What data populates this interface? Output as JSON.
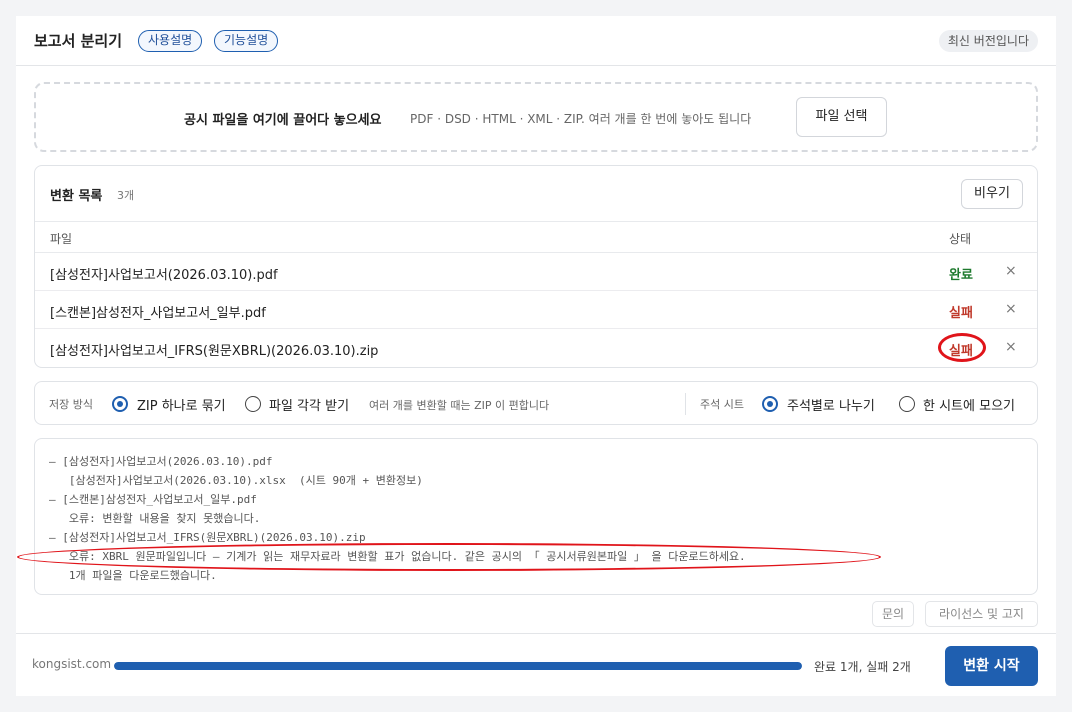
{
  "header": {
    "title": "보고서 분리기",
    "guide_label": "사용설명",
    "features_label": "기능설명",
    "version_badge": "최신 버전입니다"
  },
  "dropzone": {
    "main_text": "공시 파일을 여기에 끌어다 놓으세요",
    "sub_text": "PDF · DSD · HTML · XML · ZIP. 여러 개를 한 번에 놓아도 됩니다",
    "select_label": "파일 선택"
  },
  "list": {
    "title": "변환 목록",
    "count": "3개",
    "clear_label": "비우기",
    "col_file": "파일",
    "col_status": "상태",
    "remove_glyph": "×",
    "rows": [
      {
        "name": "[삼성전자]사업보고서(2026.03.10).pdf",
        "status": "완료"
      },
      {
        "name": "[스캔본]삼성전자_사업보고서_일부.pdf",
        "status": "실패"
      },
      {
        "name": "[삼성전자]사업보고서_IFRS(원문XBRL)(2026.03.10).zip",
        "status": "실패"
      }
    ]
  },
  "options": {
    "save_label": "저장 방식",
    "save_zip": "ZIP 하나로 묶기",
    "save_each": "파일 각각 받기",
    "save_hint": "여러 개를 변환할 때는 ZIP 이 편합니다",
    "sheet_label": "주석 시트",
    "sheet_split": "주석별로 나누기",
    "sheet_merge": "한 시트에 모으기",
    "save_selected": "zip",
    "sheet_selected": "split"
  },
  "log": {
    "lines": [
      "— [삼성전자]사업보고서(2026.03.10).pdf",
      "   [삼성전자]사업보고서(2026.03.10).xlsx  (시트 90개 + 변환정보)",
      "— [스캔본]삼성전자_사업보고서_일부.pdf",
      "   오류: 변환할 내용을 찾지 못했습니다.",
      "— [삼성전자]사업보고서_IFRS(원문XBRL)(2026.03.10).zip",
      "   오류: XBRL 원문파일입니다 — 기계가 읽는 재무자료라 변환할 표가 없습니다. 같은 공시의 「 공시서류원본파일 」 을 다운로드하세요.",
      "   1개 파일을 다운로드했습니다."
    ]
  },
  "footer": {
    "inquiry_label": "문의",
    "license_label": "라이선스 및 고지"
  },
  "bottom": {
    "domain": "kongsist.com",
    "progress": 1.0,
    "progress_text": "완료 1개, 실패 2개",
    "start_label": "변환 시작"
  },
  "colors": {
    "accent": "#1f5fb0",
    "success": "#1e7a2e",
    "failure": "#c0392b",
    "annotation": "#e0141a"
  }
}
